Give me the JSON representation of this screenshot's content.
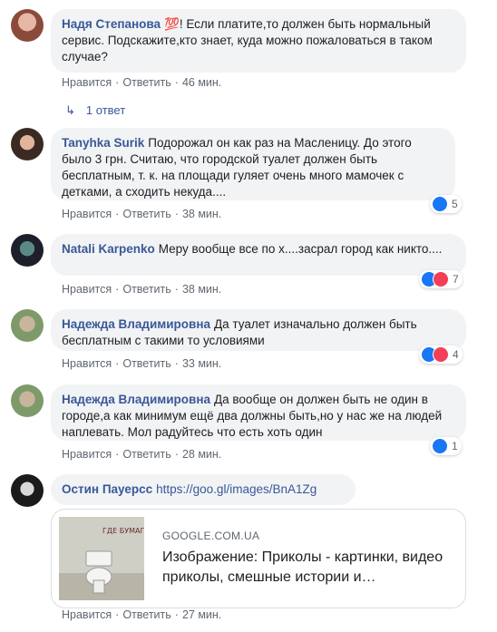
{
  "comments": [
    {
      "author": "Надя Степанова",
      "emoji": "💯",
      "text": "! Если платите,то должен быть нормальный сервис. Подскажите,кто знает, куда можно пожаловаться в таком случае?",
      "like_label": "Нравится",
      "reply_label": "Ответить",
      "time": "46 мин."
    },
    {
      "author": "Tanyhka Surik",
      "text": "Подорожал он как раз на Масленицу. До этого было 3 грн. Считаю, что городской туалет должен быть бесплатным, т. к. на площади гуляет очень много мамочек с детками, а сходить некуда....",
      "like_label": "Нравится",
      "reply_label": "Ответить",
      "time": "38 мин.",
      "reactions": "5"
    },
    {
      "author": "Natali Karpenko",
      "text": "Меру вообще все по х....засрал город как никто....",
      "like_label": "Нравится",
      "reply_label": "Ответить",
      "time": "38 мин.",
      "reactions": "7"
    },
    {
      "author": "Надежда Владимировна",
      "text": "Да туалет изначально должен быть бесплатным с такими то условиями",
      "like_label": "Нравится",
      "reply_label": "Ответить",
      "time": "33 мин.",
      "reactions": "4"
    },
    {
      "author": "Надежда Владимировна",
      "text": "Да вообще он должен быть не один в городе,а как минимум ещё два должны быть,но у нас же на людей наплевать. Мол радуйтесь что есть хоть один",
      "like_label": "Нравится",
      "reply_label": "Ответить",
      "time": "28 мин.",
      "reactions": "1"
    },
    {
      "author": "Остин Пауерсс",
      "text": "https://goo.gl/images/BnA1Zg",
      "like_label": "Нравится",
      "reply_label": "Ответить",
      "time": "27 мин."
    }
  ],
  "replies_toggle": "1 ответ",
  "link_preview": {
    "domain": "GOOGLE.COM.UA",
    "title": "Изображение: Приколы - картинки, видео приколы, смешные истории и…",
    "thumb_text": "ГДЕ БУМАГА?!"
  },
  "colors": {
    "author": "#385898",
    "bubble": "#f2f3f5",
    "meta": "#606770",
    "like": "#1877f2",
    "love": "#f33e58"
  }
}
